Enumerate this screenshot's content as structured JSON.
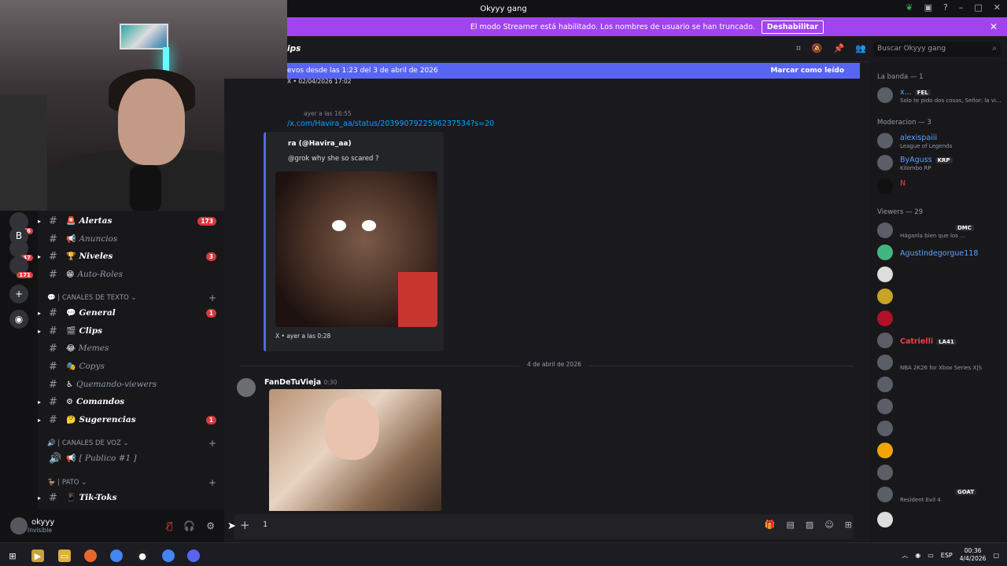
{
  "window": {
    "title": "Okyyy gang"
  },
  "streamer_banner": {
    "text": "El modo Streamer está habilitado. Los nombres de usuario se han truncado.",
    "button": "Deshabilitar"
  },
  "channel_header": {
    "title": "ips"
  },
  "search": {
    "placeholder": "Buscar Okyyy gang"
  },
  "new_messages": {
    "text": "evos desde las 1:23 del 3 de abril de 2026",
    "mark": "Marcar como leído"
  },
  "servers": {
    "badges": [
      "46",
      "47",
      "171"
    ]
  },
  "channels": [
    {
      "emoji": "🚨",
      "name": "Alertas",
      "count": "173",
      "bold": true
    },
    {
      "emoji": "📢",
      "name": "Anuncios",
      "bold": false
    },
    {
      "emoji": "🏆",
      "name": "Niveles",
      "count": "3",
      "bold": true
    },
    {
      "emoji": "😁",
      "name": "Auto-Roles",
      "bold": false
    }
  ],
  "category_text": "| CANALES DE TEXTO",
  "text_channels": [
    {
      "emoji": "💬",
      "name": "General",
      "count": "1",
      "bold": true
    },
    {
      "emoji": "🎬",
      "name": "Clips",
      "bold": true
    },
    {
      "emoji": "😂",
      "name": "Memes",
      "bold": false
    },
    {
      "emoji": "🎭",
      "name": "Copys",
      "bold": false
    },
    {
      "emoji": "♿",
      "name": "Quemando-viewers",
      "bold": false
    },
    {
      "emoji": "⚙",
      "name": "Comandos",
      "bold": true
    },
    {
      "emoji": "🤔",
      "name": "Sugerencias",
      "count": "1",
      "bold": true
    }
  ],
  "category_voice": "| CANALES DE VOZ",
  "voice_channel": {
    "emoji": "📢",
    "name": "[ Publico #1 ]"
  },
  "category_pato": "| PATO",
  "pato_channel": {
    "emoji": "📱",
    "name": "Tik-Toks"
  },
  "user": {
    "name": "okyyy",
    "status": "Invisible"
  },
  "chat": {
    "first_line": "X • 02/04/2026 17:02",
    "ts1": "ayer a las 16:55",
    "link": "/x.com/Havira_aa/status/2039907922596237534?s=20",
    "embed_author": "ra (@Havira_aa)",
    "embed_desc": "@grok why she so scared ?",
    "embed_footer": "X • ayer a las 0:28",
    "date_divider": "4 de abril de 2026",
    "author2": "FanDeTuVieja",
    "ts2": "0:30"
  },
  "composer": {
    "text": "1"
  },
  "members": {
    "banda_header": "La banda — 1",
    "moderacion_header": "Moderacion — 3",
    "viewers_header": "Viewers — 29",
    "banda": [
      {
        "name": "x...",
        "tag": "FEL",
        "activity": "Solo te pido dos cosas, Señor: la vi...",
        "color": "#5ea1ff"
      }
    ],
    "mods": [
      {
        "name": "alexispaiii",
        "activity": "League of Legends",
        "color": "#5ea1ff"
      },
      {
        "name": "ByAguss",
        "tag": "KRP",
        "activity": "Kilombo RP",
        "color": "#5ea1ff"
      },
      {
        "name": "N",
        "activity": "",
        "color": "#f23f43"
      }
    ],
    "viewers": [
      {
        "name": "",
        "tag": "DMC",
        "activity": "Háganla bien que los ...",
        "color": "#a33"
      },
      {
        "name": "Agustindegorgue118",
        "activity": "",
        "color": "#5ea1ff"
      },
      {
        "name": "",
        "activity": "",
        "color": "#a33"
      },
      {
        "name": "",
        "activity": "",
        "color": "#a33"
      },
      {
        "name": "",
        "activity": "",
        "color": "#a33"
      },
      {
        "name": "Catrielli",
        "tag": "LA41",
        "activity": "",
        "color": "#f23f43"
      },
      {
        "name": "",
        "activity": "NBA 2K26 for Xbox Series X|S",
        "color": "#a33"
      },
      {
        "name": "",
        "activity": "",
        "color": "#a33"
      },
      {
        "name": "",
        "activity": "",
        "color": "#a33"
      },
      {
        "name": "",
        "activity": "",
        "color": "#a33"
      },
      {
        "name": "",
        "activity": "",
        "color": "#a33"
      },
      {
        "name": "",
        "activity": "",
        "color": "#a33"
      },
      {
        "name": "",
        "tag": "GOAT",
        "activity": "Resident Evil 4",
        "color": "#a33"
      },
      {
        "name": "",
        "activity": "",
        "color": "#a33"
      }
    ]
  },
  "taskbar": {
    "lang": "ESP",
    "time": "00:36",
    "date": "4/4/2026"
  }
}
